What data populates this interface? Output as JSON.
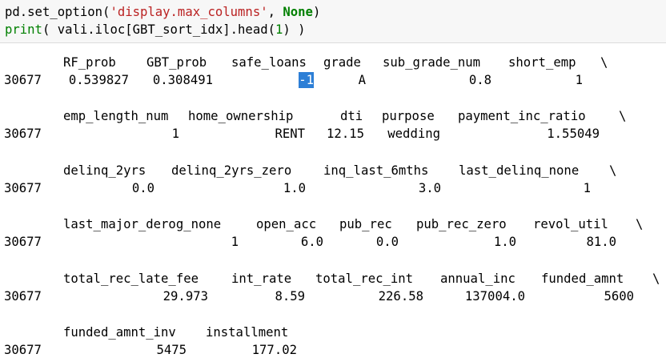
{
  "code": {
    "line1": {
      "prefix": "pd.set_option(",
      "string": "'display.max_columns'",
      "sep": ", ",
      "keyword": "None",
      "suffix": ")"
    },
    "line2": {
      "func": "print",
      "middle": "( vali.iloc[GBT_sort_idx].head(",
      "number": "1",
      "suffix": ") )"
    }
  },
  "output": {
    "index_label": "30677",
    "continuation": "\\",
    "blocks": [
      {
        "columns": [
          "RF_prob",
          "GBT_prob",
          "safe_loans",
          "grade",
          "sub_grade_num",
          "short_emp"
        ],
        "values": [
          "0.539827",
          "0.308491",
          "-1",
          "A",
          "0.8",
          "1"
        ],
        "continued": true
      },
      {
        "columns": [
          "emp_length_num",
          "home_ownership",
          "dti",
          "purpose",
          "payment_inc_ratio"
        ],
        "values": [
          "1",
          "RENT",
          "12.15",
          "wedding",
          "1.55049"
        ],
        "continued": true
      },
      {
        "columns": [
          "delinq_2yrs",
          "delinq_2yrs_zero",
          "inq_last_6mths",
          "last_delinq_none"
        ],
        "values": [
          "0.0",
          "1.0",
          "3.0",
          "1"
        ],
        "continued": true
      },
      {
        "columns": [
          "last_major_derog_none",
          "open_acc",
          "pub_rec",
          "pub_rec_zero",
          "revol_util"
        ],
        "values": [
          "1",
          "6.0",
          "0.0",
          "1.0",
          "81.0"
        ],
        "continued": true
      },
      {
        "columns": [
          "total_rec_late_fee",
          "int_rate",
          "total_rec_int",
          "annual_inc",
          "funded_amnt"
        ],
        "values": [
          "29.973",
          "8.59",
          "226.58",
          "137004.0",
          "5600"
        ],
        "continued": true
      },
      {
        "columns": [
          "funded_amnt_inv",
          "installment"
        ],
        "values": [
          "5475",
          "177.02"
        ],
        "continued": false
      }
    ],
    "highlighted_value": "-1"
  }
}
